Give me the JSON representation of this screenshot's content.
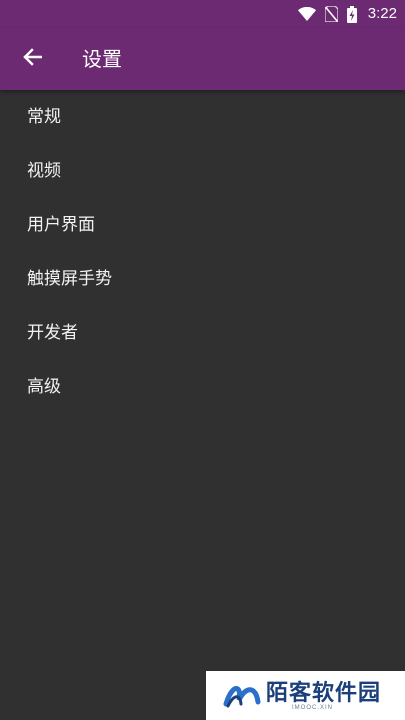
{
  "status_bar": {
    "time": "3:22",
    "icons": [
      "wifi-icon",
      "no-sim-icon",
      "battery-charging-icon"
    ]
  },
  "app_bar": {
    "back_icon": "arrow-left-icon",
    "title": "设置"
  },
  "menu": {
    "items": [
      {
        "label": "常规"
      },
      {
        "label": "视频"
      },
      {
        "label": "用户界面"
      },
      {
        "label": "触摸屏手势"
      },
      {
        "label": "开发者"
      },
      {
        "label": "高级"
      }
    ]
  },
  "watermark": {
    "text": "陌客软件园",
    "subtext": "IMOOC.XIN"
  },
  "colors": {
    "toolbar": "#6c2a73",
    "background": "#303030",
    "text": "#f2f2f2",
    "watermark_text": "#1b3f7a"
  }
}
